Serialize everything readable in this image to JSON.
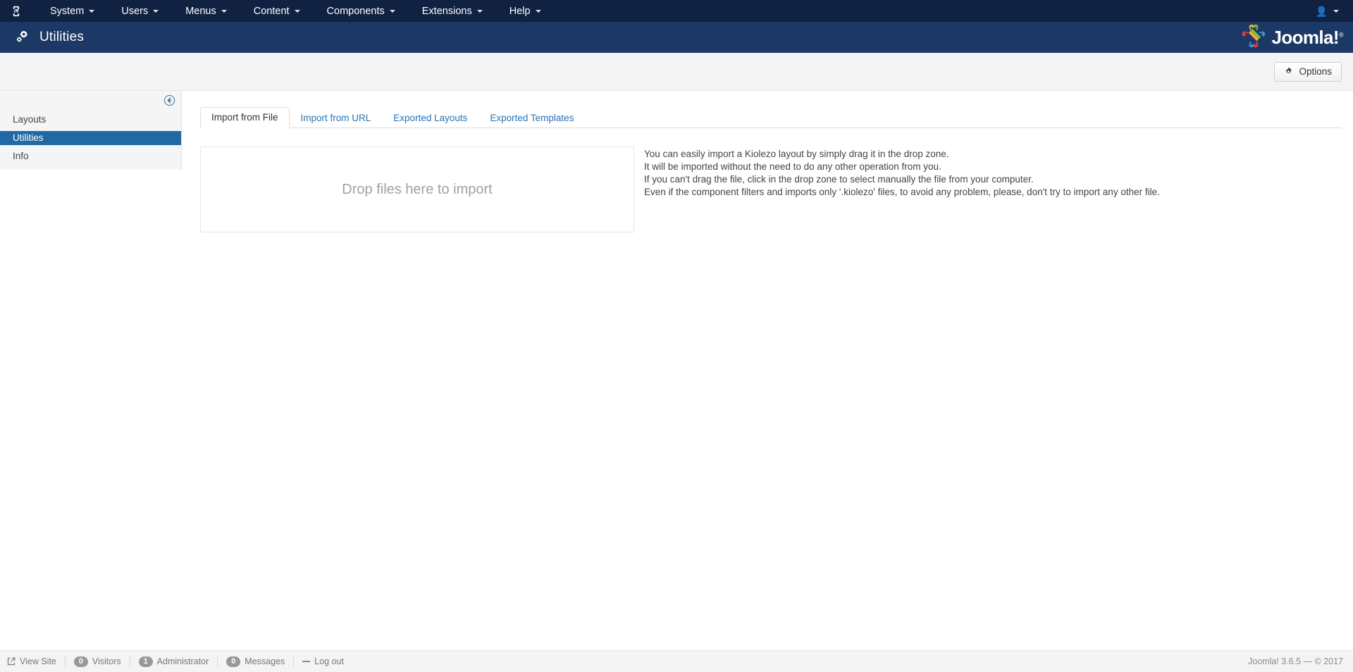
{
  "colors": {
    "menubar_bg": "#102141",
    "header_bg": "#1c3864",
    "accent_blue": "#1f6aa5",
    "link_blue": "#2a73b1",
    "toolbar_bg": "#f4f4f4",
    "sidebar_bg": "#f5f5f5"
  },
  "menubar": {
    "brand_icon": "joomla-brand-icon",
    "items": [
      {
        "label": "System",
        "has_caret": true
      },
      {
        "label": "Users",
        "has_caret": true
      },
      {
        "label": "Menus",
        "has_caret": true
      },
      {
        "label": "Content",
        "has_caret": true
      },
      {
        "label": "Components",
        "has_caret": true
      },
      {
        "label": "Extensions",
        "has_caret": true
      },
      {
        "label": "Help",
        "has_caret": true
      }
    ],
    "user_menu": {
      "icon": "user-icon",
      "caret": "chevron-down-icon"
    }
  },
  "header": {
    "icon": "cogs-icon",
    "title": "Utilities",
    "logo_text": "Joomla!",
    "logo_mark": "joomla-logo-icon",
    "logo_registered": "®"
  },
  "toolbar": {
    "options_label": "Options",
    "options_icon": "gear-icon"
  },
  "sidebar": {
    "collapse_icon": "arrow-circle-left-icon",
    "items": [
      {
        "label": "Layouts",
        "active": false
      },
      {
        "label": "Utilities",
        "active": true
      },
      {
        "label": "Info",
        "active": false
      }
    ]
  },
  "main": {
    "tabs": [
      {
        "label": "Import from File",
        "active": true
      },
      {
        "label": "Import from URL",
        "active": false
      },
      {
        "label": "Exported Layouts",
        "active": false
      },
      {
        "label": "Exported Templates",
        "active": false
      }
    ],
    "dropzone": {
      "text": "Drop files here to import"
    },
    "instructions": [
      "You can easily import a Kiolezo layout by simply drag it in the drop zone.",
      "It will be imported without the need to do any other operation from you.",
      "If you can't drag the file, click in the drop zone to select manually the file from your computer.",
      "Even if the component filters and imports only '.kiolezo' files, to avoid any problem, please, don't try to import any other file."
    ]
  },
  "status_bar": {
    "view_site": {
      "label": "View Site",
      "icon": "external-link-icon"
    },
    "counters": [
      {
        "count": "0",
        "label": "Visitors"
      },
      {
        "count": "1",
        "label": "Administrator"
      },
      {
        "count": "0",
        "label": "Messages"
      }
    ],
    "logout": {
      "label": "Log out",
      "icon": "logout-icon"
    },
    "version_info": "Joomla! 3.6.5  —  © 2017"
  }
}
